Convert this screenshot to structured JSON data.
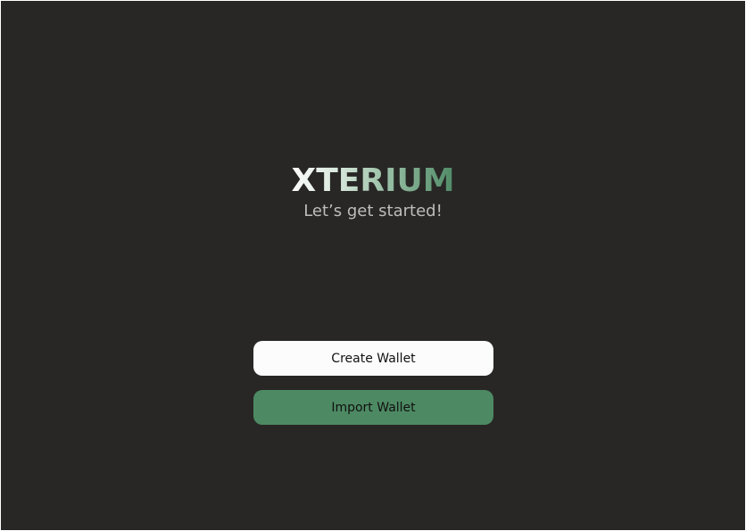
{
  "app": {
    "brand": "XTERIUM",
    "tagline": "Let’s get started!"
  },
  "actions": {
    "create_label": "Create Wallet",
    "import_label": "Import Wallet"
  },
  "colors": {
    "background": "#282726",
    "accent": "#4d8a63",
    "primary_button": "#fbfcfb"
  }
}
